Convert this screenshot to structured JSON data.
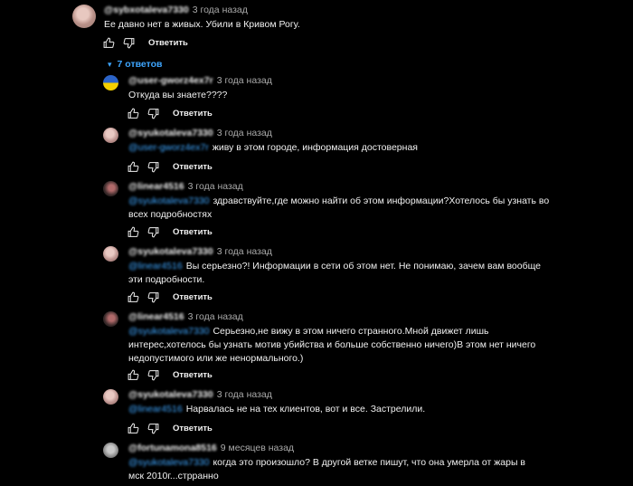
{
  "top_comment": {
    "author": "@sybxotaleva7330",
    "date": "3 года назад",
    "text": "Ее давно нет в живых. Убили в Кривом Рогу.",
    "reply_label": "Ответить"
  },
  "replies_toggle": {
    "chevron": "▾",
    "label": "7 ответов"
  },
  "replies": [
    {
      "author": "@user-gworz4ex7r",
      "date": "3 года назад",
      "mention": "",
      "text": "Откуда вы знаете????",
      "reply_label": "Ответить"
    },
    {
      "author": "@syukotaleva7330",
      "date": "3 года назад",
      "mention": "@user-gworz4ex7r",
      "text": "живу в этом городе, информация достоверная",
      "reply_label": "Ответить"
    },
    {
      "author": "@linear4516",
      "date": "3 года назад",
      "mention": "@syukotaleva7330",
      "text": "здравствуйте,где можно найти об этом информации?Хотелось бы узнать во всех подробностях",
      "reply_label": "Ответить"
    },
    {
      "author": "@syukotaleva7330",
      "date": "3 года назад",
      "mention": "@linear4516",
      "text": "Вы серьезно?! Информации в сети об этом нет. Не понимаю, зачем  вам вообще эти подробности.",
      "reply_label": "Ответить"
    },
    {
      "author": "@linear4516",
      "date": "3 года назад",
      "mention": "@syukotaleva7330",
      "text": "Серьезно,не вижу в  этом ничего странного.Мной движет лишь интерес,хотелось бы узнать мотив убийства и больше собственно ничего)В этом нет ничего недопустимого или же ненормального.)",
      "reply_label": "Ответить"
    },
    {
      "author": "@syukotaleva7330",
      "date": "3 года назад",
      "mention": "@linear4516",
      "text": "Нарвалась не на тех клиентов, вот и все. Застрелили.",
      "reply_label": "Ответить"
    },
    {
      "author": "@fortunamona8516",
      "date": "9 месяцев назад",
      "mention": "@syukotaleva7330",
      "text": "когда это произошло? В другой ветке пишут, что она умерла от жары в мск 2010г...стрранно",
      "reply_label": ""
    }
  ],
  "colors": {
    "background": "#000000",
    "link": "#3ea6ff",
    "meta": "#aaaaaa"
  }
}
